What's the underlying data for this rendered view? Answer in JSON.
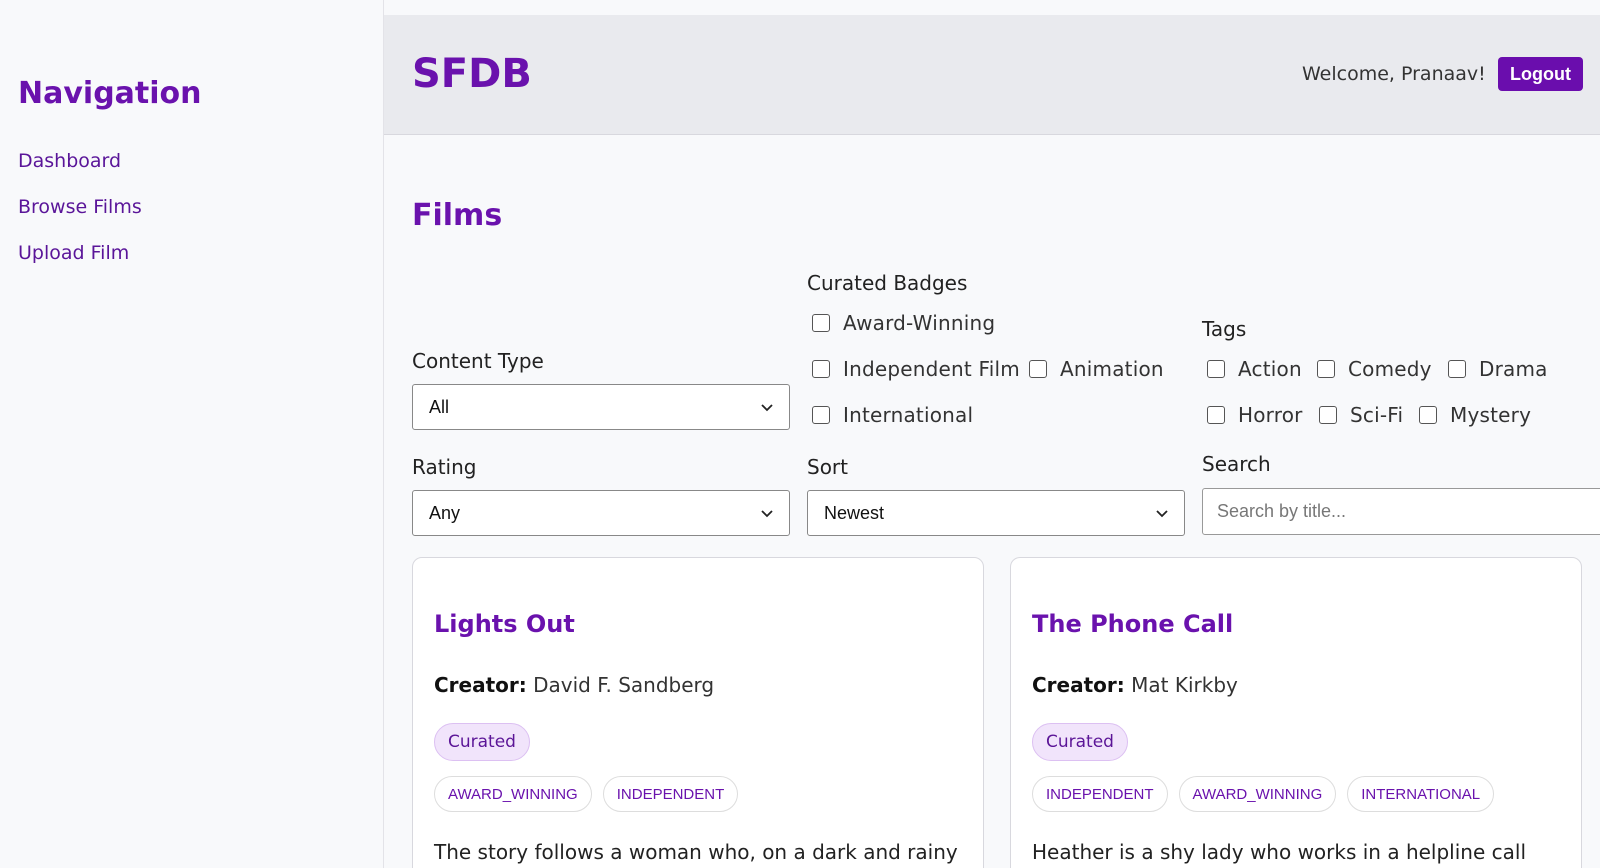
{
  "sidebar": {
    "title": "Navigation",
    "items": [
      {
        "label": "Dashboard"
      },
      {
        "label": "Browse Films"
      },
      {
        "label": "Upload Film"
      }
    ]
  },
  "header": {
    "brand": "SFDB",
    "welcome": "Welcome, Pranaav!",
    "logout_label": "Logout"
  },
  "main": {
    "title": "Films",
    "filters": {
      "content_type": {
        "label": "Content Type",
        "value": "All"
      },
      "curated_badges": {
        "label": "Curated Badges",
        "options": [
          "Award-Winning",
          "Independent Film",
          "Animation",
          "International"
        ]
      },
      "tags": {
        "label": "Tags",
        "options": [
          "Action",
          "Comedy",
          "Drama",
          "Horror",
          "Sci-Fi",
          "Mystery"
        ]
      },
      "rating": {
        "label": "Rating",
        "value": "Any"
      },
      "sort": {
        "label": "Sort",
        "value": "Newest"
      },
      "search": {
        "label": "Search",
        "placeholder": "Search by title..."
      }
    },
    "films": [
      {
        "title": "Lights Out",
        "creator_label": "Creator:",
        "creator": "David F. Sandberg",
        "curated": "Curated",
        "tags": [
          "AWARD_WINNING",
          "INDEPENDENT"
        ],
        "description": "The story follows a woman who, on a dark and rainy"
      },
      {
        "title": "The Phone Call",
        "creator_label": "Creator:",
        "creator": "Mat Kirkby",
        "curated": "Curated",
        "tags": [
          "INDEPENDENT",
          "AWARD_WINNING",
          "INTERNATIONAL"
        ],
        "description": "Heather is a shy lady who works in a helpline call"
      }
    ]
  },
  "colors": {
    "accent": "#6a12ad",
    "button": "#6a0dad",
    "header_bg": "#e9eaee",
    "page_bg": "#f8f9fb",
    "curated_bg": "#f1e4fb"
  }
}
